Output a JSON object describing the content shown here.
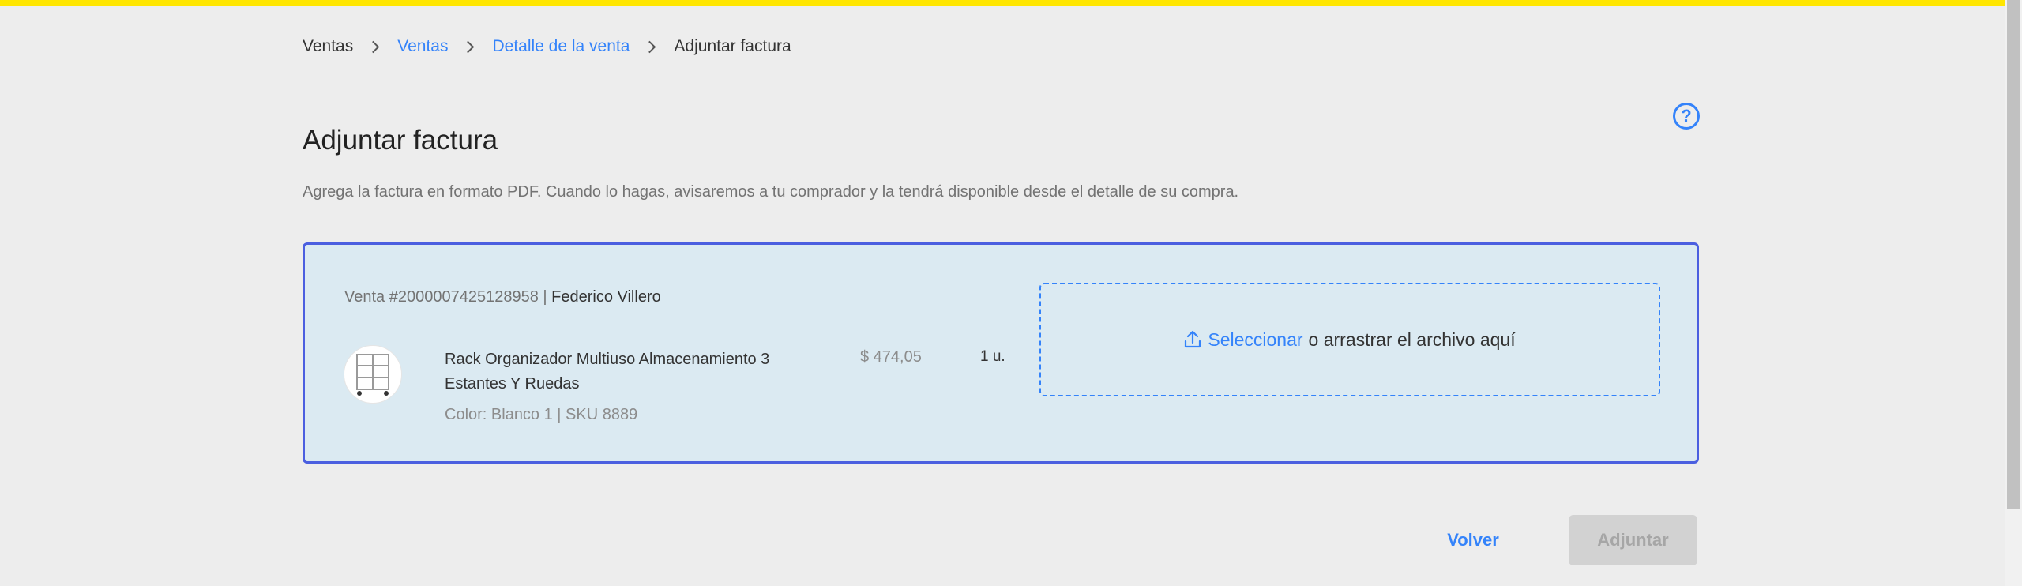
{
  "breadcrumb": {
    "items": [
      {
        "label": "Ventas"
      },
      {
        "label": "Ventas"
      },
      {
        "label": "Detalle de la venta"
      },
      {
        "label": "Adjuntar factura"
      }
    ]
  },
  "page": {
    "title": "Adjuntar factura",
    "description": "Agrega la factura en formato PDF. Cuando lo hagas, avisaremos a tu comprador y la tendrá disponible desde el detalle de su compra."
  },
  "sale": {
    "number_label": "Venta #2000007425128958",
    "separator": "|",
    "buyer": "Federico Villero",
    "product": {
      "title": "Rack Organizador Multiuso Almacenamiento 3 Estantes Y Ruedas",
      "attributes": "Color: Blanco 1 | SKU 8889",
      "price": "$ 474,05",
      "quantity": "1 u."
    }
  },
  "upload": {
    "select_label": "Seleccionar",
    "drop_label": "o arrastrar el archivo aquí"
  },
  "actions": {
    "back_label": "Volver",
    "attach_label": "Adjuntar"
  },
  "icons": {
    "help": "help-circle-icon",
    "upload": "upload-icon",
    "chevron": "chevron-right-icon"
  },
  "colors": {
    "accent": "#3483fa",
    "top_bar": "#ffe600",
    "card_border": "#4b5fe0",
    "card_bg": "#dbeaf2"
  }
}
